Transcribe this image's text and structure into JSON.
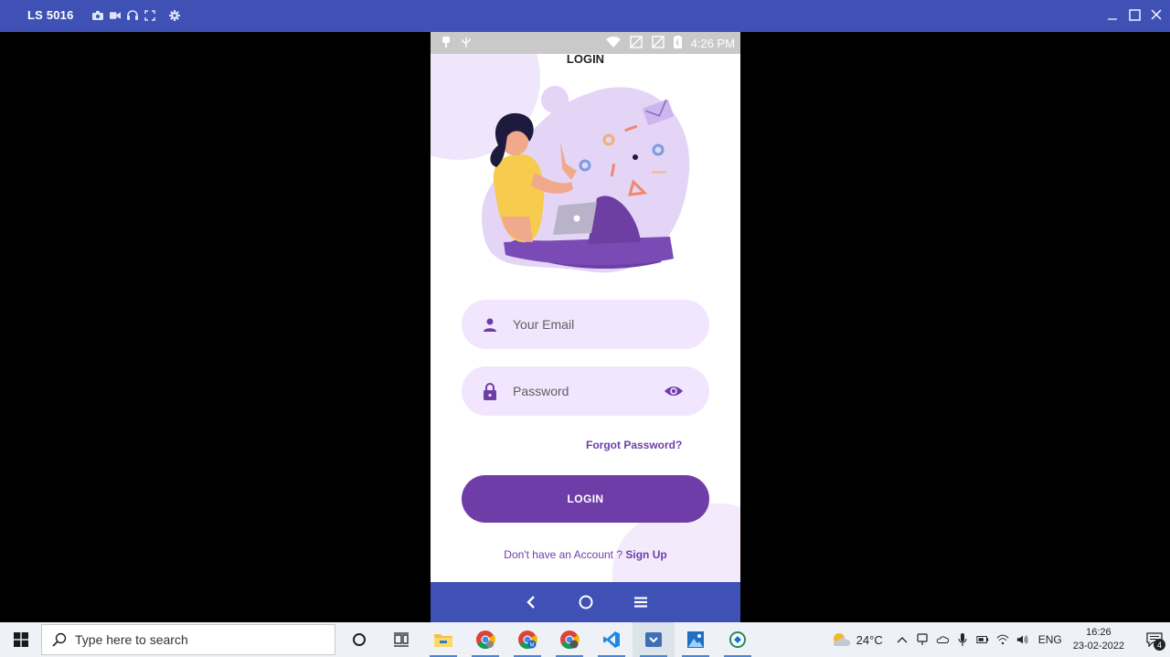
{
  "emulator": {
    "device_name": "LS 5016",
    "tool_icons": [
      "camera-icon",
      "video-camera-icon",
      "headphones-icon",
      "fullscreen-icon",
      "settings-icon"
    ],
    "window_controls": [
      "minimize-icon",
      "maximize-icon",
      "close-icon"
    ]
  },
  "phone": {
    "status_bar": {
      "time": "4:26 PM"
    },
    "page_title": "LOGIN",
    "email_field": {
      "placeholder": "Your Email",
      "icon": "person-icon"
    },
    "password_field": {
      "placeholder": "Password",
      "icon": "lock-icon",
      "toggle_icon": "eye-icon"
    },
    "forgot_password": "Forgot Password?",
    "login_button": "LOGIN",
    "signup_prompt": "Don't have an Account ? ",
    "signup_link": "Sign Up",
    "nav_buttons": [
      "back-icon",
      "home-icon",
      "menu-icon"
    ]
  },
  "taskbar": {
    "search_placeholder": "Type here to search",
    "weather_temp": "24°C",
    "language": "ENG",
    "time": "16:26",
    "date": "23-02-2022",
    "notification_count": "4"
  },
  "colors": {
    "title_bar": "#3f51b5",
    "primary_purple": "#6f3da7",
    "field_bg": "#f1e6fd",
    "taskbar": "#eef2f6"
  }
}
